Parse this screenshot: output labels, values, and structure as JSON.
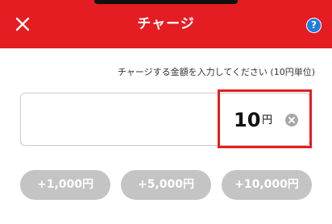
{
  "header": {
    "title": "チャージ",
    "close_icon": "close-icon",
    "help_label": "?",
    "background_color": "#e41d22"
  },
  "instruction": "チャージする金額を入力してください (10円単位)",
  "amount": {
    "value": "10",
    "unit": "円",
    "clear_icon": "clear-icon"
  },
  "quick_amounts": [
    {
      "label": "+1,000円"
    },
    {
      "label": "+5,000円"
    },
    {
      "label": "+10,000円"
    }
  ],
  "colors": {
    "accent": "#e41d22",
    "help": "#1e7ee0",
    "quick_button": "#c4c4c4"
  }
}
